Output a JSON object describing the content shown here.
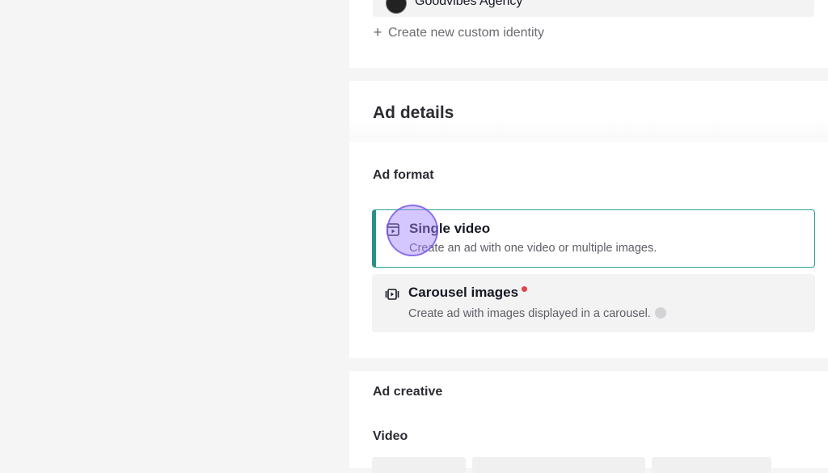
{
  "identity": {
    "selected_name": "Goodvibes Agency",
    "create_link": "Create new custom identity",
    "plus_symbol": "+"
  },
  "ad_details": {
    "title": "Ad details",
    "format_label": "Ad format",
    "options": [
      {
        "title": "Single video",
        "description": "Create an ad with one video or multiple images.",
        "selected": true,
        "icon": "video-frame-icon"
      },
      {
        "title": "Carousel images",
        "description": "Create ad with images displayed in a carousel.",
        "selected": false,
        "icon": "carousel-icon",
        "new_indicator": true,
        "info_icon": true
      }
    ]
  },
  "ad_creative": {
    "title": "Ad creative",
    "video_label": "Video"
  },
  "colors": {
    "accent": "#2c8f8a",
    "new_dot": "#e0454a",
    "cursor_highlight": "#a082ff"
  }
}
